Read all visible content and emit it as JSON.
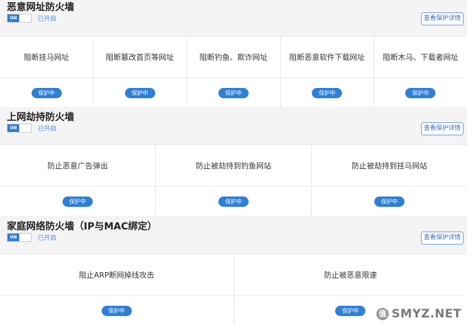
{
  "sections": [
    {
      "title": "恶意网址防火墙",
      "toggle": "ON",
      "status": "已开启",
      "detail_button": "查看保护详情",
      "cards": [
        {
          "label": "阻断挂马网址",
          "badge": "保护中"
        },
        {
          "label": "阻断篡改首页等网址",
          "badge": "保护中"
        },
        {
          "label": "阻断钓鱼、欺诈网址",
          "badge": "保护中"
        },
        {
          "label": "阻断恶意软件下载网址",
          "badge": "保护中"
        },
        {
          "label": "阻断木马、下载者网址",
          "badge": "保护中"
        }
      ]
    },
    {
      "title": "上网劫持防火墙",
      "toggle": "ON",
      "status": "已开启",
      "detail_button": "查看保护详情",
      "cards": [
        {
          "label": "防止恶意广告弹出",
          "badge": "保护中"
        },
        {
          "label": "防止被劫持到钓鱼网站",
          "badge": "保护中"
        },
        {
          "label": "防止被劫持到挂马网站",
          "badge": "保护中"
        }
      ]
    },
    {
      "title": "家庭网络防火墙（IP与MAC绑定）",
      "toggle": "ON",
      "status": "已开启",
      "detail_button": "查看保护详情",
      "cards": [
        {
          "label": "阻止ARP断网掉线攻击",
          "badge": "保护中"
        },
        {
          "label": "防止被恶意限速",
          "badge": "保护中"
        }
      ]
    }
  ],
  "watermark": {
    "logo": "值",
    "text": "SMYZ.NET"
  },
  "colors": {
    "accent": "#2f7fd6",
    "detail_border": "#6f9fd9"
  }
}
